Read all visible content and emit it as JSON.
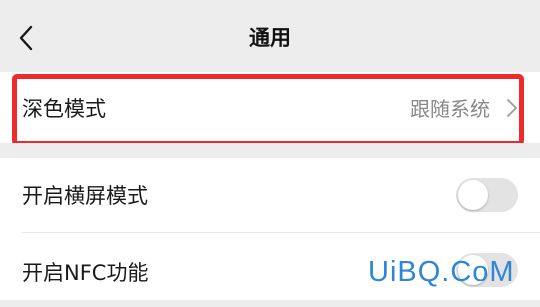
{
  "header": {
    "title": "通用",
    "back_icon": "chevron-left-icon"
  },
  "dark_mode": {
    "label": "深色模式",
    "value": "跟随系统",
    "highlight_color": "#ee2a2a"
  },
  "landscape_mode": {
    "label": "开启横屏模式",
    "enabled": false
  },
  "nfc": {
    "label": "开启NFC功能",
    "enabled": false
  },
  "watermark": {
    "text": "UiBQ.CoM",
    "color": "#2f86d6"
  }
}
